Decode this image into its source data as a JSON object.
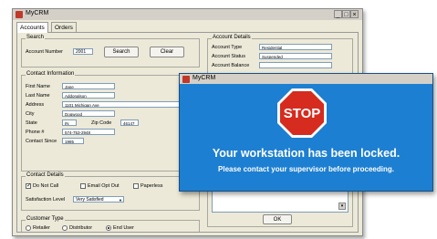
{
  "app": {
    "title": "MyCRM",
    "window_controls": {
      "minimize": "_",
      "maximize": "□",
      "close": "×"
    },
    "tabs": [
      {
        "label": "Accounts",
        "selected": true
      },
      {
        "label": "Orders",
        "selected": false
      }
    ]
  },
  "search": {
    "group_label": "Search",
    "account_number_label": "Account Number",
    "account_number_value": "2001",
    "search_button": "Search",
    "clear_button": "Clear"
  },
  "account_details": {
    "group_label": "Account Details",
    "account_type_label": "Account Type",
    "account_type_value": "Residential",
    "account_status_label": "Account Status",
    "account_status_value": "Suspended",
    "account_balance_label": "Account Balance",
    "ok_button": "OK"
  },
  "contact_info": {
    "group_label": "Contact Information",
    "first_name_label": "First Name",
    "first_name_value": "Jane",
    "last_name_label": "Last Name",
    "last_name_value": "Addonalson",
    "address_label": "Address",
    "address_value": "1101 Michigan Ave",
    "city_label": "City",
    "city_value": "Dogwood",
    "state_label": "State",
    "state_value": "IN",
    "zip_label": "Zip Code",
    "zip_value": "46147",
    "phone_label": "Phone #",
    "phone_value": "574-753-2948",
    "contact_since_label": "Contact Since",
    "contact_since_value": "1985"
  },
  "contact_details": {
    "group_label": "Contact Details",
    "do_not_call": {
      "label": "Do Not Call",
      "checked": true
    },
    "email_opt_out": {
      "label": "Email Opt Out",
      "checked": false
    },
    "paperless": {
      "label": "Paperless",
      "checked": false
    },
    "satisfaction_label": "Satisfaction Level",
    "satisfaction_value": "Very Satisfied"
  },
  "customer_type": {
    "group_label": "Customer Type",
    "options": [
      {
        "label": "Retailer",
        "selected": false
      },
      {
        "label": "Distributor",
        "selected": false
      },
      {
        "label": "End User",
        "selected": true
      }
    ]
  },
  "lock_dialog": {
    "title": "MyCRM",
    "stop_sign": "STOP",
    "message": "Your workstation has been locked.",
    "submessage": "Please contact your supervisor before proceeding.",
    "colors": {
      "background": "#1d7fd1",
      "stop_red": "#d62b1f"
    }
  }
}
